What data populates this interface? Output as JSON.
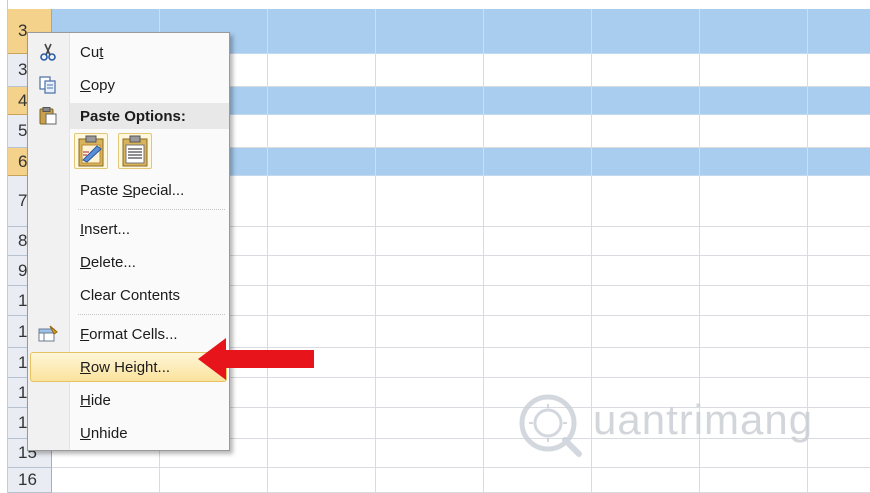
{
  "sheet": {
    "row_headers": [
      "3",
      "3",
      "4",
      "5",
      "6",
      "7",
      "8",
      "9",
      "10",
      "11",
      "12",
      "13",
      "14",
      "15",
      "16"
    ],
    "selected_rows": [
      0,
      2,
      4
    ]
  },
  "context_menu": {
    "items": [
      {
        "label": "Cut",
        "icon": "scissors-icon",
        "underline": "t"
      },
      {
        "label": "Copy",
        "icon": "copy-icon",
        "underline": "C"
      },
      {
        "label": "Paste Options:",
        "icon": "clipboard-icon"
      },
      {
        "label": "Paste Special...",
        "underline": "S"
      },
      {
        "label": "Insert...",
        "underline": "I"
      },
      {
        "label": "Delete...",
        "underline": "D"
      },
      {
        "label": "Clear Contents",
        "underline": "N"
      },
      {
        "label": "Format Cells...",
        "icon": "format-cells-icon",
        "underline": "F"
      },
      {
        "label": "Row Height...",
        "underline": "R",
        "highlighted": true
      },
      {
        "label": "Hide",
        "underline": "H"
      },
      {
        "label": "Unhide",
        "underline": "U"
      }
    ],
    "paste_buttons": [
      "paste-formatting-icon",
      "paste-values-icon"
    ]
  },
  "annotation": {
    "arrow_color": "#e8141c"
  },
  "watermark": {
    "text": "uantrimang",
    "logo": "Q"
  },
  "colors": {
    "selection": "#a9cdee",
    "row_header_selected": "#f4d28b",
    "menu_highlight": "#fbe39d"
  }
}
